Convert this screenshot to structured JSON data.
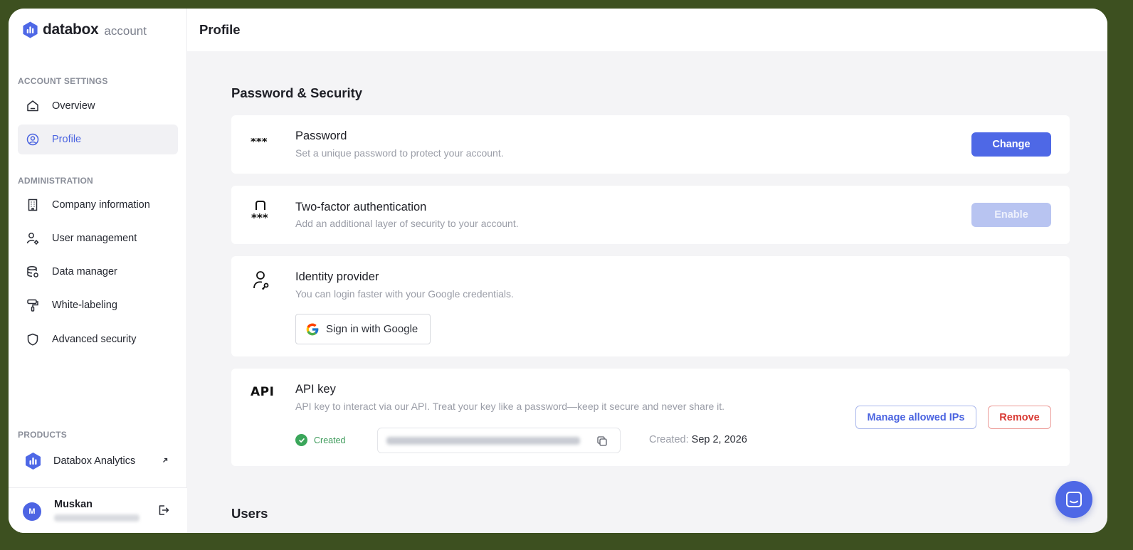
{
  "brand": {
    "name": "databox",
    "sub": "account"
  },
  "colors": {
    "accent": "#4e68e6",
    "danger": "#d93a34",
    "success": "#3aa65a"
  },
  "header": {
    "title": "Profile"
  },
  "sidebar": {
    "account_settings_title": "ACCOUNT SETTINGS",
    "account_items": [
      {
        "label": "Overview",
        "icon": "home-icon"
      },
      {
        "label": "Profile",
        "icon": "user-circle-icon",
        "active": true
      }
    ],
    "administration_title": "ADMINISTRATION",
    "admin_items": [
      {
        "label": "Company information",
        "icon": "building-icon"
      },
      {
        "label": "User management",
        "icon": "user-gear-icon"
      },
      {
        "label": "Data manager",
        "icon": "database-icon"
      },
      {
        "label": "White-labeling",
        "icon": "paint-roller-icon"
      },
      {
        "label": "Advanced security",
        "icon": "shield-icon"
      }
    ],
    "products_title": "PRODUCTS",
    "product": {
      "label": "Databox Analytics",
      "icon": "external-link-icon"
    }
  },
  "user": {
    "initial": "M",
    "name": "Muskan"
  },
  "security": {
    "heading": "Password & Security",
    "password": {
      "icon_text": "***",
      "title": "Password",
      "desc": "Set a unique password to protect your account.",
      "button": "Change"
    },
    "two_factor": {
      "icon_text": "***",
      "title": "Two-factor authentication",
      "desc": "Add an additional layer of security to your account.",
      "button": "Enable"
    },
    "identity": {
      "title": "Identity provider",
      "desc": "You can login faster with your Google credentials.",
      "button": "Sign in with Google"
    },
    "api": {
      "icon_text": "API",
      "title": "API key",
      "desc": "API key to interact via our API. Treat your key like a password—keep it secure and never share it.",
      "status": "Created",
      "created_label": "Created:",
      "created_date": "Sep 2, 2026",
      "manage_button": "Manage allowed IPs",
      "remove_button": "Remove"
    }
  },
  "users": {
    "heading": "Users"
  }
}
